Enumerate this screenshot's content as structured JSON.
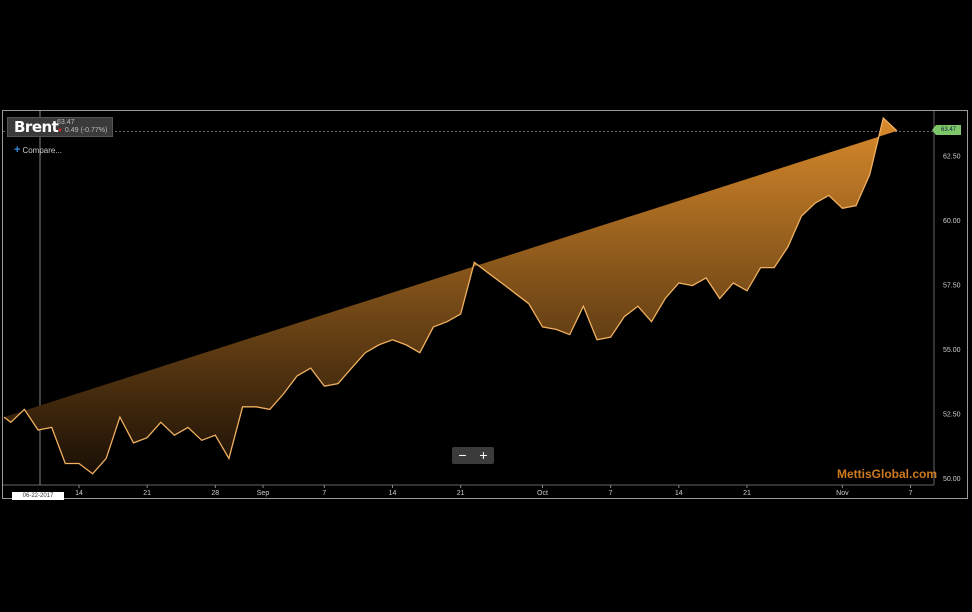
{
  "legend": {
    "name": "Brent",
    "price": "63.47",
    "change": "0.49 (-0.77%)"
  },
  "compare_label": "Compare...",
  "zoom": {
    "out_label": "−",
    "in_label": "+"
  },
  "watermark": "MettisGlobal.com",
  "crosshair_date": "06-22-2017",
  "last_price_tag": "63.47",
  "colors": {
    "area_top": "#d98a2b",
    "area_bottom": "#1a0f05",
    "line": "#f0b060",
    "price_tag": "#7dc66a",
    "down_arrow": "#e0202a"
  },
  "chart_data": {
    "type": "area",
    "title": "Brent",
    "ylim": [
      50.0,
      64.0
    ],
    "y_ticks": [
      "50.00",
      "52.50",
      "55.00",
      "57.50",
      "60.00",
      "62.50"
    ],
    "y_tick_values": [
      50.0,
      52.5,
      55.0,
      57.5,
      60.0,
      62.5
    ],
    "x_ticks": [
      {
        "label": "14",
        "x": 11
      },
      {
        "label": "21",
        "x": 16
      },
      {
        "label": "28",
        "x": 21
      },
      {
        "label": "Sep",
        "x": 24.5
      },
      {
        "label": "7",
        "x": 29
      },
      {
        "label": "14",
        "x": 34
      },
      {
        "label": "21",
        "x": 39
      },
      {
        "label": "Oct",
        "x": 45
      },
      {
        "label": "7",
        "x": 50
      },
      {
        "label": "14",
        "x": 55
      },
      {
        "label": "21",
        "x": 60
      },
      {
        "label": "Nov",
        "x": 67
      },
      {
        "label": "7",
        "x": 72
      }
    ],
    "x": [
      5.5,
      6,
      7,
      8,
      9,
      10,
      11,
      12,
      13,
      14,
      15,
      16,
      17,
      18,
      19,
      20,
      21,
      22,
      23,
      24,
      25,
      26,
      27,
      28,
      29,
      30,
      31,
      32,
      33,
      34,
      35,
      36,
      37,
      38,
      39,
      40,
      41,
      42,
      43,
      44,
      45,
      46,
      47,
      48,
      49,
      50,
      51,
      52,
      53,
      54,
      55,
      56,
      57,
      58,
      59,
      60,
      61,
      62,
      63,
      64,
      65,
      66,
      67,
      68,
      69,
      70,
      71,
      72,
      73
    ],
    "values": [
      52.4,
      52.2,
      52.7,
      51.9,
      52.0,
      50.6,
      50.6,
      50.2,
      50.8,
      52.4,
      51.4,
      51.6,
      52.2,
      51.7,
      52.0,
      51.5,
      51.7,
      50.8,
      52.8,
      52.8,
      52.7,
      53.3,
      54.0,
      54.3,
      53.6,
      53.7,
      54.3,
      54.9,
      55.2,
      55.4,
      55.2,
      54.9,
      55.9,
      56.1,
      56.4,
      58.4,
      58.0,
      57.6,
      57.2,
      56.8,
      55.9,
      55.8,
      55.6,
      56.7,
      55.4,
      55.5,
      56.3,
      56.7,
      56.1,
      57.0,
      57.6,
      57.5,
      57.8,
      57.0,
      57.6,
      57.3,
      58.2,
      58.2,
      59.0,
      60.2,
      60.7,
      61.0,
      60.5,
      60.6,
      61.8,
      64.0,
      63.5
    ]
  }
}
